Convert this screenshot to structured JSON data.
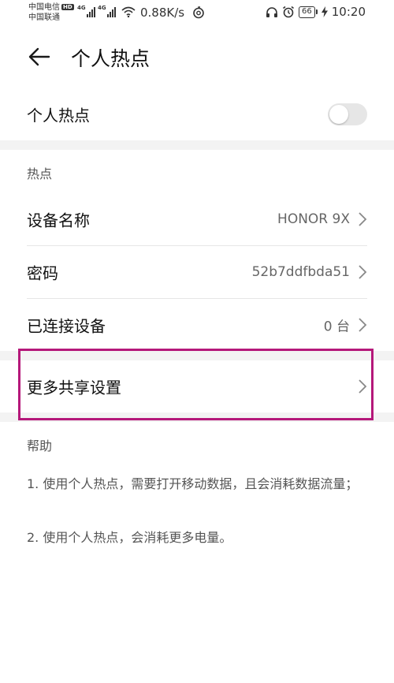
{
  "status_bar": {
    "carrier1": "中国电信",
    "hd": "HD",
    "carrier2": "中国联通",
    "net1": "4G",
    "net2": "4G",
    "speed": "0.88K/s",
    "battery": "66",
    "time": "10:20",
    "icons": [
      "signal-icon",
      "wifi-icon",
      "netease-music-icon",
      "headset-icon",
      "alarm-icon",
      "battery-icon",
      "charging-icon"
    ]
  },
  "header": {
    "title": "个人热点",
    "back_icon": "arrow-left-icon"
  },
  "hotspot_toggle": {
    "label": "个人热点",
    "on": false
  },
  "hotspot_section": {
    "header": "热点",
    "items": [
      {
        "label": "设备名称",
        "value": "HONOR 9X"
      },
      {
        "label": "密码",
        "value": "52b7ddfbda51"
      },
      {
        "label": "已连接设备",
        "value": "0 台"
      }
    ]
  },
  "more_sharing": {
    "label": "更多共享设置",
    "highlight_color": "#b5187a"
  },
  "help": {
    "header": "帮助",
    "lines": [
      "1. 使用个人热点，需要打开移动数据，且会消耗数据流量；",
      "2. 使用个人热点，会消耗更多电量。"
    ]
  }
}
